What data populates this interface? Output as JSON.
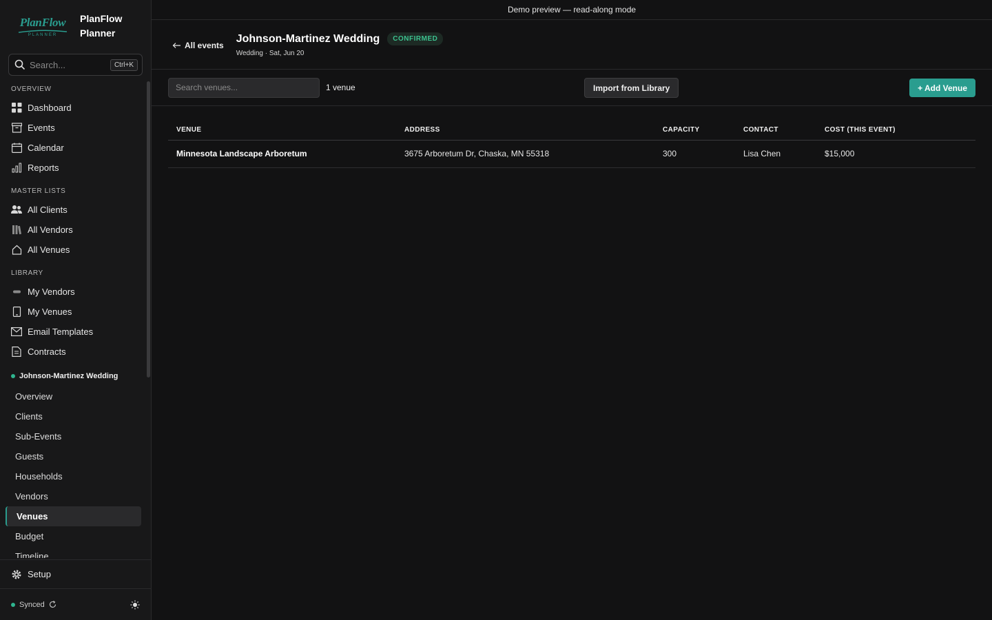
{
  "app": {
    "logo_text": "PlanFlow",
    "logo_sub": "PLANNER",
    "name_line1": "PlanFlow",
    "name_line2": "Planner"
  },
  "search": {
    "placeholder": "Search...",
    "shortcut": "Ctrl+K"
  },
  "sidebar": {
    "overview_label": "OVERVIEW",
    "overview_items": [
      {
        "label": "Dashboard",
        "icon": "grid-icon"
      },
      {
        "label": "Events",
        "icon": "archive-icon"
      },
      {
        "label": "Calendar",
        "icon": "calendar-icon"
      },
      {
        "label": "Reports",
        "icon": "bar-chart-icon"
      }
    ],
    "master_label": "MASTER LISTS",
    "master_items": [
      {
        "label": "All Clients",
        "icon": "users-icon"
      },
      {
        "label": "All Vendors",
        "icon": "books-icon"
      },
      {
        "label": "All Venues",
        "icon": "home-icon"
      }
    ],
    "library_label": "LIBRARY",
    "library_items": [
      {
        "label": "My Vendors",
        "icon": "pill-icon"
      },
      {
        "label": "My Venues",
        "icon": "building-icon"
      },
      {
        "label": "Email Templates",
        "icon": "mail-icon"
      },
      {
        "label": "Contracts",
        "icon": "document-icon"
      }
    ],
    "event_name": "Johnson-Martinez Wedding",
    "event_items": [
      "Overview",
      "Clients",
      "Sub-Events",
      "Guests",
      "Households",
      "Vendors",
      "Venues",
      "Budget",
      "Timeline"
    ],
    "active_event_item": "Venues",
    "setup_label": "Setup",
    "sync_status": "Synced"
  },
  "banner": "Demo preview — read-along mode",
  "header": {
    "back_label": "All events",
    "title": "Johnson-Martinez Wedding",
    "status": "CONFIRMED",
    "subtitle": "Wedding · Sat, Jun 20"
  },
  "toolbar": {
    "search_placeholder": "Search venues...",
    "count": "1 venue",
    "import_label": "Import from Library",
    "add_label": "+ Add Venue"
  },
  "table": {
    "columns": [
      "VENUE",
      "ADDRESS",
      "CAPACITY",
      "CONTACT",
      "COST (THIS EVENT)"
    ],
    "rows": [
      {
        "venue": "Minnesota Landscape Arboretum",
        "address": "3675 Arboretum Dr, Chaska, MN 55318",
        "capacity": "300",
        "contact": "Lisa Chen",
        "cost": "$15,000"
      }
    ]
  },
  "colors": {
    "accent": "#2a9d8f",
    "status_green": "#3cc28f",
    "background": "#121213"
  }
}
